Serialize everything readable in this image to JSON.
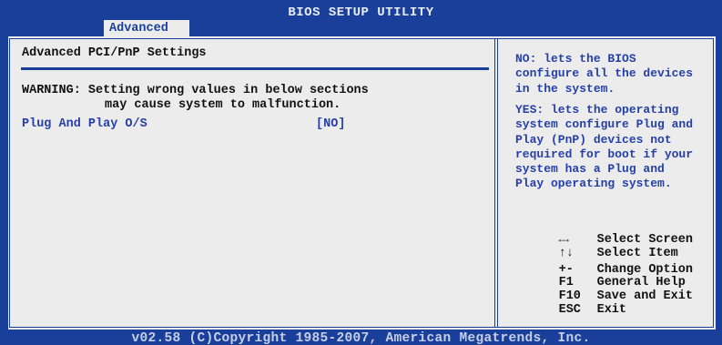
{
  "app": {
    "title": "BIOS SETUP UTILITY"
  },
  "tabs": [
    {
      "label": "Advanced",
      "selected": true
    }
  ],
  "main": {
    "section_title": "Advanced PCI/PnP Settings",
    "warning_line1": "WARNING: Setting wrong values in below sections",
    "warning_line2": "may cause system to malfunction.",
    "settings": [
      {
        "label": "Plug And Play O/S",
        "value": "[NO]"
      }
    ]
  },
  "help": {
    "paragraph1": "NO: lets the BIOS configure all the devices in the system.",
    "paragraph2": "YES: lets the operating system configure Plug and Play (PnP) devices not required for boot if your system has a Plug and Play operating system."
  },
  "legend": [
    {
      "key": "←→",
      "icon": "left-right-arrows-icon",
      "action": "Select Screen"
    },
    {
      "key": "↑↓",
      "icon": "up-down-arrows-icon",
      "action": "Select Item"
    },
    {
      "key": "+-",
      "action": "Change Option"
    },
    {
      "key": "F1",
      "action": "General Help"
    },
    {
      "key": "F10",
      "action": "Save and Exit"
    },
    {
      "key": "ESC",
      "action": "Exit"
    }
  ],
  "footer": {
    "copyright": "v02.58 (C)Copyright 1985-2007, American Megatrends, Inc."
  },
  "colors": {
    "background": "#1a3f9a",
    "panel": "#ececec",
    "text_blue": "#2640a8"
  }
}
